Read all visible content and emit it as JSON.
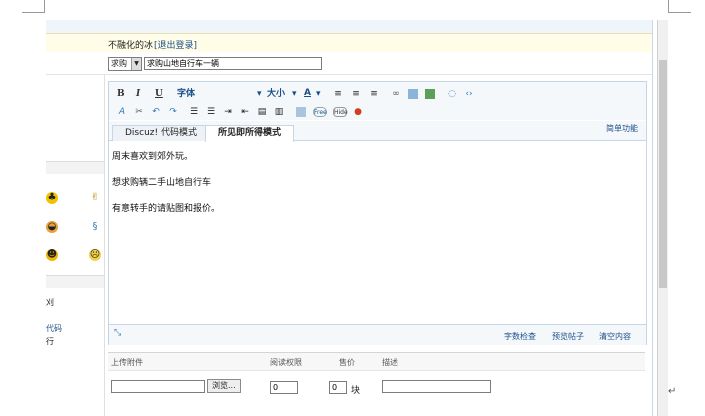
{
  "login": {
    "user": "不融化的冰",
    "logout": "[退出登录]"
  },
  "post": {
    "type_select": "求购",
    "title_value": "求购山地自行车一辆"
  },
  "toolbar": {
    "bold": "B",
    "italic": "I",
    "underline": "U",
    "font": "字体",
    "size": "大小",
    "simple_mode": "简单功能"
  },
  "tabs": [
    {
      "label": "Discuz! 代码模式"
    },
    {
      "label": "所见即所得模式"
    }
  ],
  "content": {
    "lines": [
      "周末喜欢到郊外玩。",
      "想求购辆二手山地自行车",
      "有意转手的请贴图和报价。"
    ]
  },
  "editor_footer": {
    "check": "字数检查",
    "preview": "预览帖子",
    "clear": "清空内容"
  },
  "attach": {
    "h_file": "上传附件",
    "h_perm": "阅读权限",
    "h_price": "售价",
    "h_desc": "描述",
    "browse": "浏览...",
    "perm_value": "0",
    "price_value": "0",
    "unit": "块"
  },
  "left": {
    "item1": "刈",
    "item2": "代码",
    "item3": "行"
  },
  "colors": {
    "accent": "#1a4f8a",
    "editor_border": "#c7d6e6"
  }
}
